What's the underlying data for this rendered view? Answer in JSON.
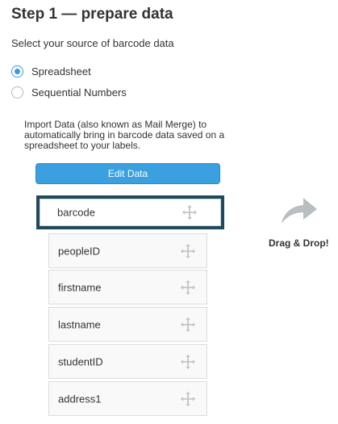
{
  "title": "Step 1 — prepare data",
  "subtitle": "Select your source of barcode data",
  "sources": [
    {
      "label": "Spreadsheet",
      "selected": true
    },
    {
      "label": "Sequential Numbers",
      "selected": false
    }
  ],
  "description": "Import Data (also known as Mail Merge) to automatically bring in barcode data saved on a spreadsheet to your labels.",
  "edit_button": "Edit Data",
  "fields": [
    "barcode",
    "peopleID",
    "firstname",
    "lastname",
    "studentID",
    "address1"
  ],
  "drag_label": "Drag & Drop!",
  "colors": {
    "accent": "#3aa0e0",
    "highlight_border": "#1f4a5c",
    "arrow": "#b9bec0"
  }
}
